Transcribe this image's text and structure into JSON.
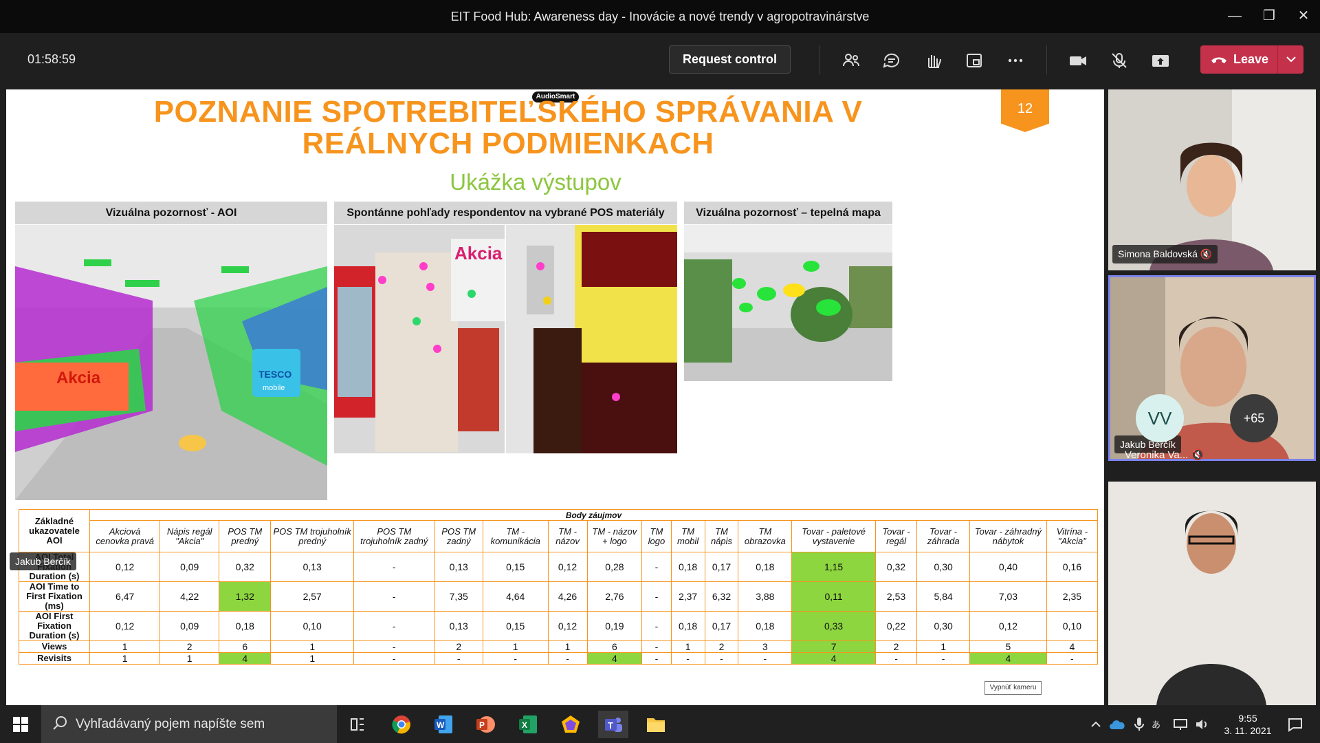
{
  "window": {
    "title": "EIT Food Hub: Awareness day - Inovácie a nové trendy v agropotravinárstve",
    "timer": "01:58:59",
    "request_control": "Request control",
    "leave_label": "Leave"
  },
  "slide": {
    "logo": "AudioSmart",
    "title": "POZNANIE SPOTREBITEĽSKÉHO SPRÁVANIA V REÁLNYCH PODMIENKACH",
    "page_number": "12",
    "subtitle": "Ukážka výstupov",
    "panels": [
      "Vizuálna pozornosť - AOI",
      "Spontánne pohľady respondentov na vybrané POS materiály",
      "Vizuálna pozornosť – tepelná mapa"
    ],
    "photo_labels": {
      "akcia": "Akcia",
      "tesco": "TESCO",
      "mobile": "mobile"
    },
    "table": {
      "group_header": "Body záujmov",
      "row_header": "Základné ukazovatele AOI",
      "columns": [
        "Akciová cenovka pravá",
        "Nápis regál \"Akcia\"",
        "POS TM predný",
        "POS TM trojuholník predný",
        "POS TM trojuholník zadný",
        "POS TM zadný",
        "TM - komunikácia",
        "TM - názov",
        "TM - názov + logo",
        "TM logo",
        "TM mobil",
        "TM nápis",
        "TM obrazovka",
        "Tovar - paletové vystavenie",
        "Tovar - regál",
        "Tovar - záhrada",
        "Tovar - záhradný nábytok",
        "Vitrína - \"Akcia\""
      ],
      "rows": [
        {
          "label": "AOI Total Fixation Duration (s)",
          "values": [
            "0,12",
            "0,09",
            "0,32",
            "0,13",
            "-",
            "0,13",
            "0,15",
            "0,12",
            "0,28",
            "-",
            "0,18",
            "0,17",
            "0,18",
            "1,15",
            "0,32",
            "0,30",
            "0,40",
            "0,16"
          ],
          "highlight": [
            13
          ]
        },
        {
          "label": "AOI Time to First Fixation (ms)",
          "values": [
            "6,47",
            "4,22",
            "1,32",
            "2,57",
            "-",
            "7,35",
            "4,64",
            "4,26",
            "2,76",
            "-",
            "2,37",
            "6,32",
            "3,88",
            "0,11",
            "2,53",
            "5,84",
            "7,03",
            "2,35"
          ],
          "highlight": [
            2,
            13
          ]
        },
        {
          "label": "AOI First Fixation Duration (s)",
          "values": [
            "0,12",
            "0,09",
            "0,18",
            "0,10",
            "-",
            "0,13",
            "0,15",
            "0,12",
            "0,19",
            "-",
            "0,18",
            "0,17",
            "0,18",
            "0,33",
            "0,22",
            "0,30",
            "0,12",
            "0,10"
          ],
          "highlight": [
            13
          ]
        },
        {
          "label": "Views",
          "values": [
            "1",
            "2",
            "6",
            "1",
            "-",
            "2",
            "1",
            "1",
            "6",
            "-",
            "1",
            "2",
            "3",
            "7",
            "2",
            "1",
            "5",
            "4"
          ],
          "highlight": [
            13
          ]
        },
        {
          "label": "Revisits",
          "values": [
            "1",
            "1",
            "4",
            "1",
            "-",
            "-",
            "-",
            "-",
            "4",
            "-",
            "-",
            "-",
            "-",
            "4",
            "-",
            "-",
            "4",
            "-"
          ],
          "highlight": [
            2,
            8,
            13,
            16
          ]
        }
      ]
    },
    "presenter_badge": "Jakub Berčík",
    "camera_button": "Vypnúť kameru"
  },
  "participants": {
    "p1": "Simona Baldovská",
    "p2": "Jakub Berčík",
    "p3_initials": "VV",
    "p3_name": "Veronika Va...",
    "more_count": "+65"
  },
  "taskbar": {
    "search_placeholder": "Vyhľadávaný pojem napíšte sem",
    "time": "9:55",
    "date": "3. 11. 2021"
  },
  "colors": {
    "accent_orange": "#f7941d",
    "accent_green": "#8cc63f",
    "leave_red": "#c4314b",
    "highlight_green": "#8dd63f"
  }
}
